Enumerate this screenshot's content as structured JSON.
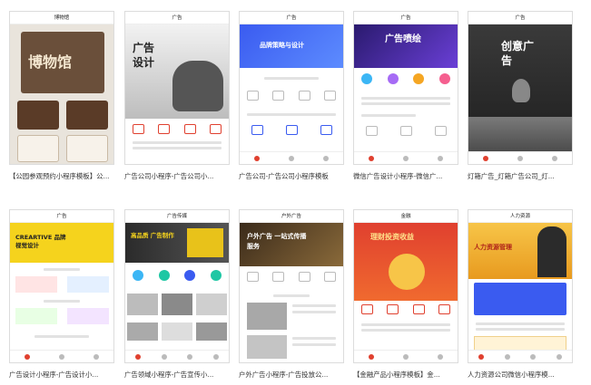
{
  "cards": [
    {
      "phone_title": "博物馆",
      "hero_text": "博物馆",
      "caption": "【公园参观预约小程序模板】公..."
    },
    {
      "phone_title": "广告",
      "hero_text": "广告设计",
      "caption": "广告公司小程序-广告公司小..."
    },
    {
      "phone_title": "广告",
      "hero_text": "品牌策略与设计",
      "caption": "广告公司-广告公司小程序模板"
    },
    {
      "phone_title": "广告",
      "hero_text": "广告喷绘",
      "caption": "微信广告设计小程序-微信广..."
    },
    {
      "phone_title": "广告",
      "hero_text": "创意广告",
      "caption": "灯箱广告_灯箱广告公司_灯..."
    },
    {
      "phone_title": "广告",
      "hero_text": "CREARTIVE 品牌视觉设计",
      "caption": "广告设计小程序-广告设计小..."
    },
    {
      "phone_title": "广告传媒",
      "hero_text": "高品质 广告制作",
      "caption": "广告领域小程序-广告宣传小..."
    },
    {
      "phone_title": "户外广告",
      "hero_text": "户外广告 一站式传播服务",
      "caption": "户外广告小程序-广告投放公..."
    },
    {
      "phone_title": "金融",
      "hero_text": "理财投资收益",
      "caption": "【金融产品小程序模板】金..."
    },
    {
      "phone_title": "人力资源",
      "hero_text": "人力资源管理",
      "caption": "人力资源公司微信小程序模..."
    }
  ],
  "colors": {
    "red": "#e0402f",
    "blue": "#3a5bf0",
    "purple": "#6a3fd6",
    "yellow": "#f5d31d",
    "dark": "#2b2b2b",
    "gold": "#f7c548"
  }
}
